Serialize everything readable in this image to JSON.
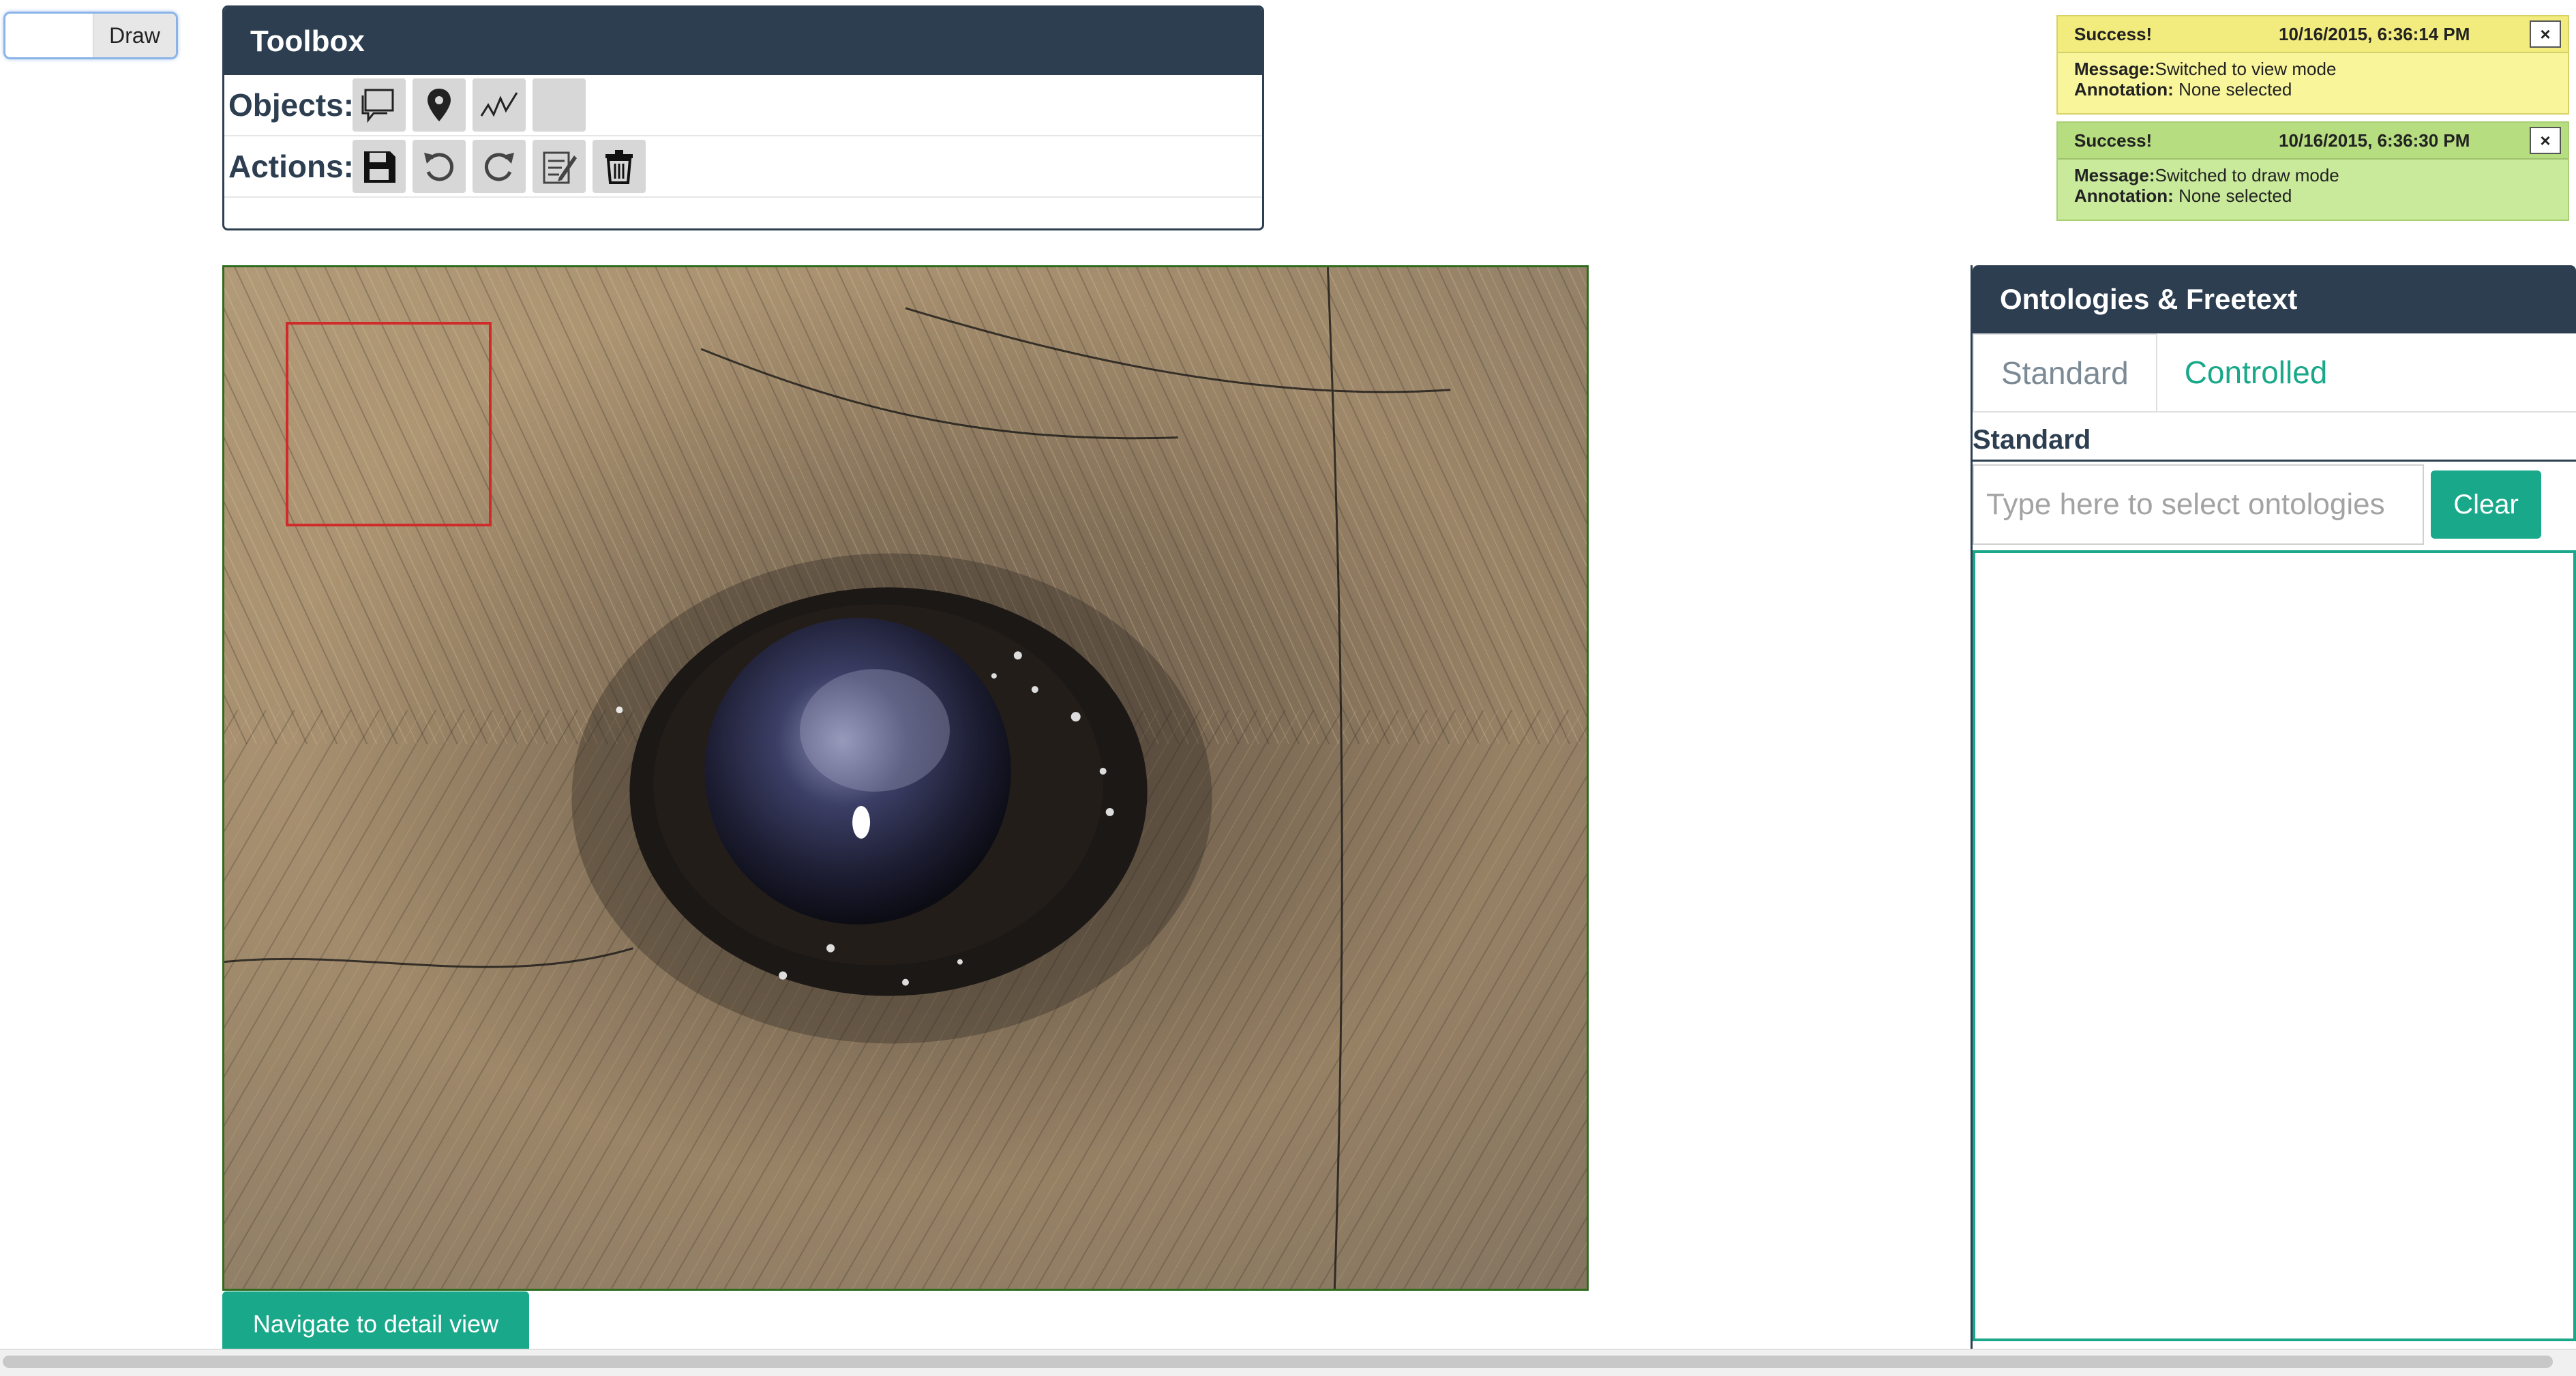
{
  "mode_toggle": {
    "view_label": "",
    "draw_label": "Draw"
  },
  "toolbox": {
    "title": "Toolbox",
    "objects_label": "Objects:",
    "actions_label": "Actions:",
    "object_tools": [
      "comment-box-icon",
      "map-pin-icon",
      "polyline-icon",
      "empty-tool"
    ],
    "action_tools": [
      "save-icon",
      "undo-icon",
      "redo-icon",
      "edit-note-icon",
      "trash-icon"
    ]
  },
  "notifications": [
    {
      "status": "Success!",
      "time": "10/16/2015, 6:36:14 PM",
      "message_label": "Message:",
      "message": "Switched to view mode",
      "annotation_label": "Annotation:",
      "annotation": "None selected",
      "close": "×",
      "color": "#f9f59a"
    },
    {
      "status": "Success!",
      "time": "10/16/2015, 6:36:30 PM",
      "message_label": "Message:",
      "message": "Switched to draw mode",
      "annotation_label": "Annotation:",
      "annotation": "None selected",
      "close": "×",
      "color": "#c9e99b"
    }
  ],
  "image_panel": {
    "subject": "close-up of animal eye with fur"
  },
  "detail_button": "Navigate to detail view",
  "ontologies": {
    "title": "Ontologies & Freetext",
    "tabs": [
      "Standard",
      "Controlled"
    ],
    "section_title": "Standard",
    "input_placeholder": "Type here to select ontologies",
    "clear_label": "Clear"
  },
  "colors": {
    "navy": "#2c3e50",
    "teal": "#1aa88a",
    "selection_red": "#d02a2a"
  }
}
